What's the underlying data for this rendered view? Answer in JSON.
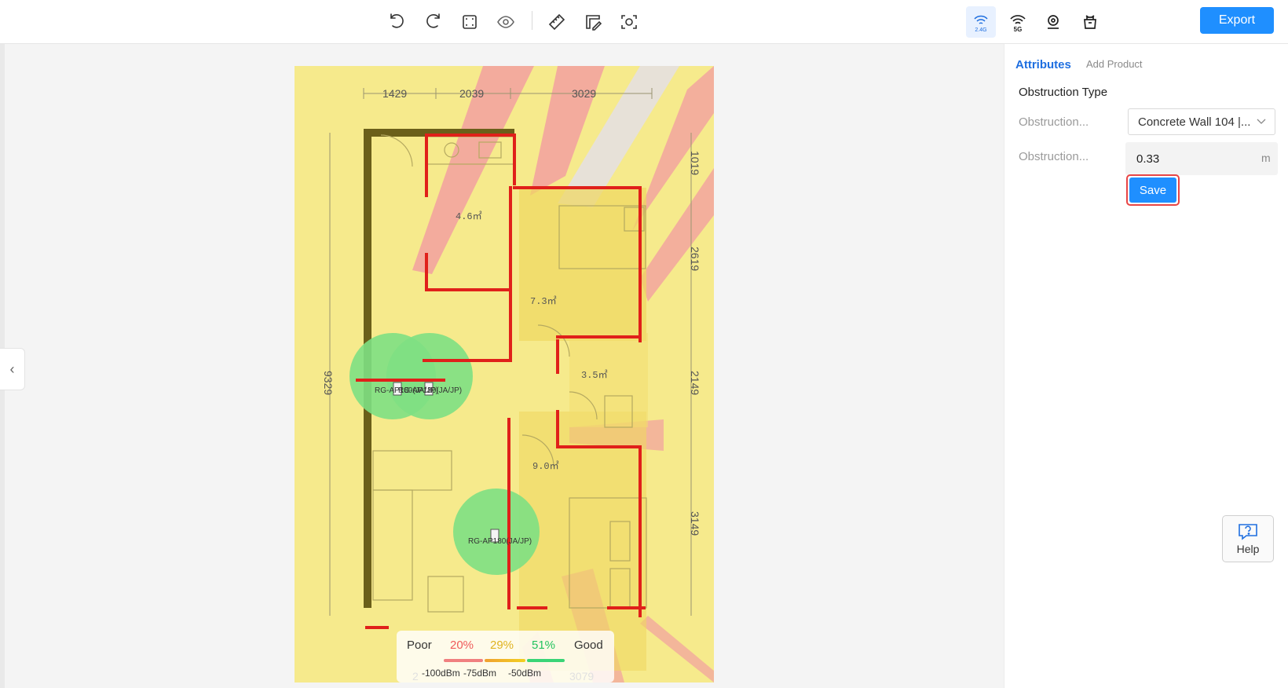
{
  "toolbar": {
    "icons": [
      "undo-icon",
      "redo-icon",
      "fit-screen-icon",
      "eye-icon",
      "ruler-icon",
      "scale-edit-icon",
      "scan-icon",
      "wifi-2g4-icon",
      "wifi-5g-icon",
      "location-icon",
      "product-icon"
    ],
    "band_24_label": "2.4G",
    "band_5_label": "5G",
    "export_label": "Export"
  },
  "floorplan": {
    "dimensions_top": [
      "1429",
      "2039",
      "3029"
    ],
    "dimensions_right": [
      "1019",
      "2619",
      "2149",
      "3149"
    ],
    "dimension_left": "9329",
    "dimensions_bottom": [
      "2",
      "3079"
    ],
    "rooms": [
      "4.6㎡",
      "7.3㎡",
      "3.5㎡",
      "9.0㎡"
    ],
    "access_points": [
      {
        "label": "RG-AP180(JA/JP)"
      },
      {
        "label": "RG-AP180(JA/JP)"
      },
      {
        "label": "RG-AP180(JA/JP)"
      }
    ]
  },
  "legend": {
    "poor": "Poor",
    "good": "Good",
    "pct_red": "20%",
    "pct_yellow": "29%",
    "pct_green": "51%",
    "dbm_low": "-100dBm",
    "dbm_mid": "-75dBm",
    "dbm_high": "-50dBm",
    "colors": {
      "red": "#f08080",
      "yellow": "#f2d020",
      "green": "#3ad476"
    }
  },
  "panel": {
    "tab_attributes": "Attributes",
    "tab_add_product": "Add Product",
    "section_title": "Obstruction Type",
    "field1_label": "Obstruction...",
    "field1_value": "Concrete Wall 104 |...",
    "field2_label": "Obstruction...",
    "field2_value": "0.33",
    "field2_unit": "m",
    "save_label": "Save"
  },
  "help": {
    "label": "Help"
  },
  "accent_color": "#1f8fff"
}
